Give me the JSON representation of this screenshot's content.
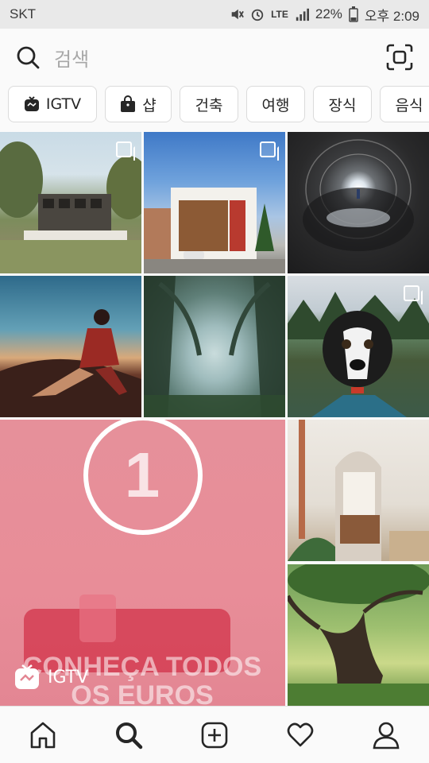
{
  "status_bar": {
    "carrier": "SKT",
    "network": "LTE",
    "battery": "22%",
    "time": "오후 2:09"
  },
  "search": {
    "placeholder": "검색"
  },
  "categories": [
    {
      "label": "IGTV",
      "icon": "igtv-icon"
    },
    {
      "label": "샵",
      "icon": "shopping-bag-icon"
    },
    {
      "label": "건축"
    },
    {
      "label": "여행"
    },
    {
      "label": "장식"
    },
    {
      "label": "음식"
    }
  ],
  "featured_tile": {
    "badge_label": "IGTV",
    "number_overlay": "1",
    "caption_line1": "CONHEÇA TODOS",
    "caption_line2": "OS EUROS"
  },
  "nav": {
    "items": [
      "home-icon",
      "search-icon",
      "add-icon",
      "heart-icon",
      "profile-icon"
    ]
  },
  "colors": {
    "featured_pink": "#e7919c",
    "accent": "#262626"
  }
}
